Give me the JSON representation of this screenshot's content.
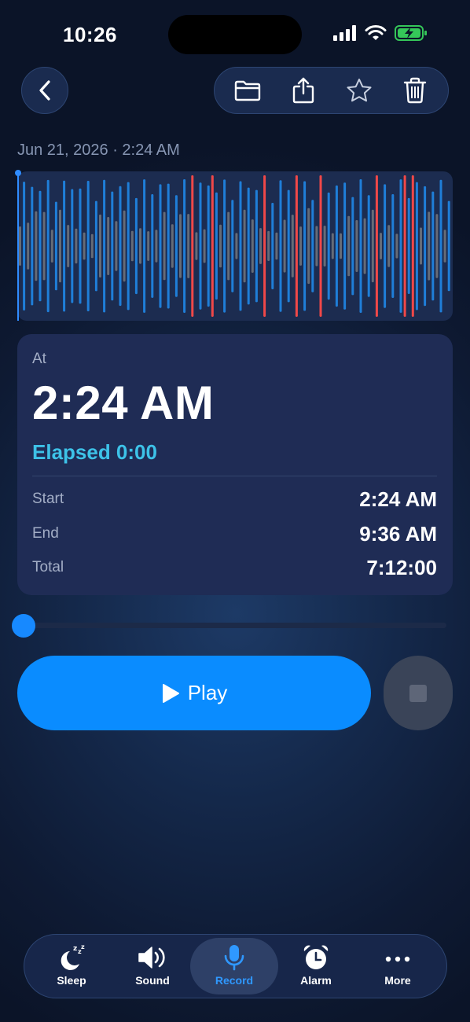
{
  "status_bar": {
    "time": "10:26"
  },
  "header": {
    "back": "back",
    "tools": [
      "folder-icon",
      "share-icon",
      "star-icon",
      "trash-icon"
    ]
  },
  "recording": {
    "date_time": "Jun 21, 2026 · 2:24 AM"
  },
  "info": {
    "at_label": "At",
    "time": "2:24 AM",
    "elapsed": "Elapsed 0:00",
    "rows": [
      {
        "label": "Start",
        "value": "2:24 AM"
      },
      {
        "label": "End",
        "value": "9:36 AM"
      },
      {
        "label": "Total",
        "value": "7:12:00"
      }
    ]
  },
  "playback": {
    "progress": 0,
    "play_label": "Play"
  },
  "tabs": [
    {
      "label": "Sleep",
      "icon": "moon-zzz-icon",
      "active": false
    },
    {
      "label": "Sound",
      "icon": "speaker-icon",
      "active": false
    },
    {
      "label": "Record",
      "icon": "microphone-icon",
      "active": true
    },
    {
      "label": "Alarm",
      "icon": "alarm-clock-icon",
      "active": false
    },
    {
      "label": "More",
      "icon": "more-dots-icon",
      "active": false
    }
  ],
  "colors": {
    "accent": "#0a8cff",
    "elapsed": "#3dc2e8",
    "wave_blue": "#1f7ed8",
    "wave_gray": "#666c78",
    "wave_red": "#f04848"
  }
}
